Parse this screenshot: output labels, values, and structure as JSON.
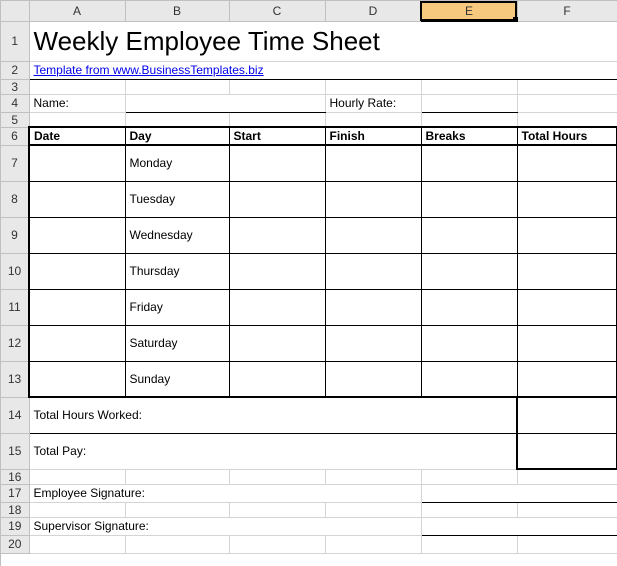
{
  "columns": [
    "A",
    "B",
    "C",
    "D",
    "E",
    "F"
  ],
  "selected_column": "E",
  "rows": [
    "1",
    "2",
    "3",
    "4",
    "5",
    "6",
    "7",
    "8",
    "9",
    "10",
    "11",
    "12",
    "13",
    "14",
    "15",
    "16",
    "17",
    "18",
    "19",
    "20"
  ],
  "title": "Weekly Employee Time Sheet",
  "subtitle_link": "Template from www.BusinessTemplates.biz",
  "labels": {
    "name": "Name:",
    "hourly_rate": "Hourly Rate:",
    "date": "Date",
    "day": "Day",
    "start": "Start",
    "finish": "Finish",
    "breaks": "Breaks",
    "total_hours": "Total Hours",
    "total_hours_worked": "Total Hours Worked:",
    "total_pay": "Total Pay:",
    "employee_signature": "Employee Signature:",
    "supervisor_signature": "Supervisor Signature:"
  },
  "days": [
    "Monday",
    "Tuesday",
    "Wednesday",
    "Thursday",
    "Friday",
    "Saturday",
    "Sunday"
  ],
  "values": {
    "name": "",
    "hourly_rate": "",
    "entries": [
      {
        "date": "",
        "start": "",
        "finish": "",
        "breaks": "",
        "total": ""
      },
      {
        "date": "",
        "start": "",
        "finish": "",
        "breaks": "",
        "total": ""
      },
      {
        "date": "",
        "start": "",
        "finish": "",
        "breaks": "",
        "total": ""
      },
      {
        "date": "",
        "start": "",
        "finish": "",
        "breaks": "",
        "total": ""
      },
      {
        "date": "",
        "start": "",
        "finish": "",
        "breaks": "",
        "total": ""
      },
      {
        "date": "",
        "start": "",
        "finish": "",
        "breaks": "",
        "total": ""
      },
      {
        "date": "",
        "start": "",
        "finish": "",
        "breaks": "",
        "total": ""
      }
    ],
    "total_hours_worked": "",
    "total_pay": "",
    "employee_signature": "",
    "supervisor_signature": ""
  }
}
